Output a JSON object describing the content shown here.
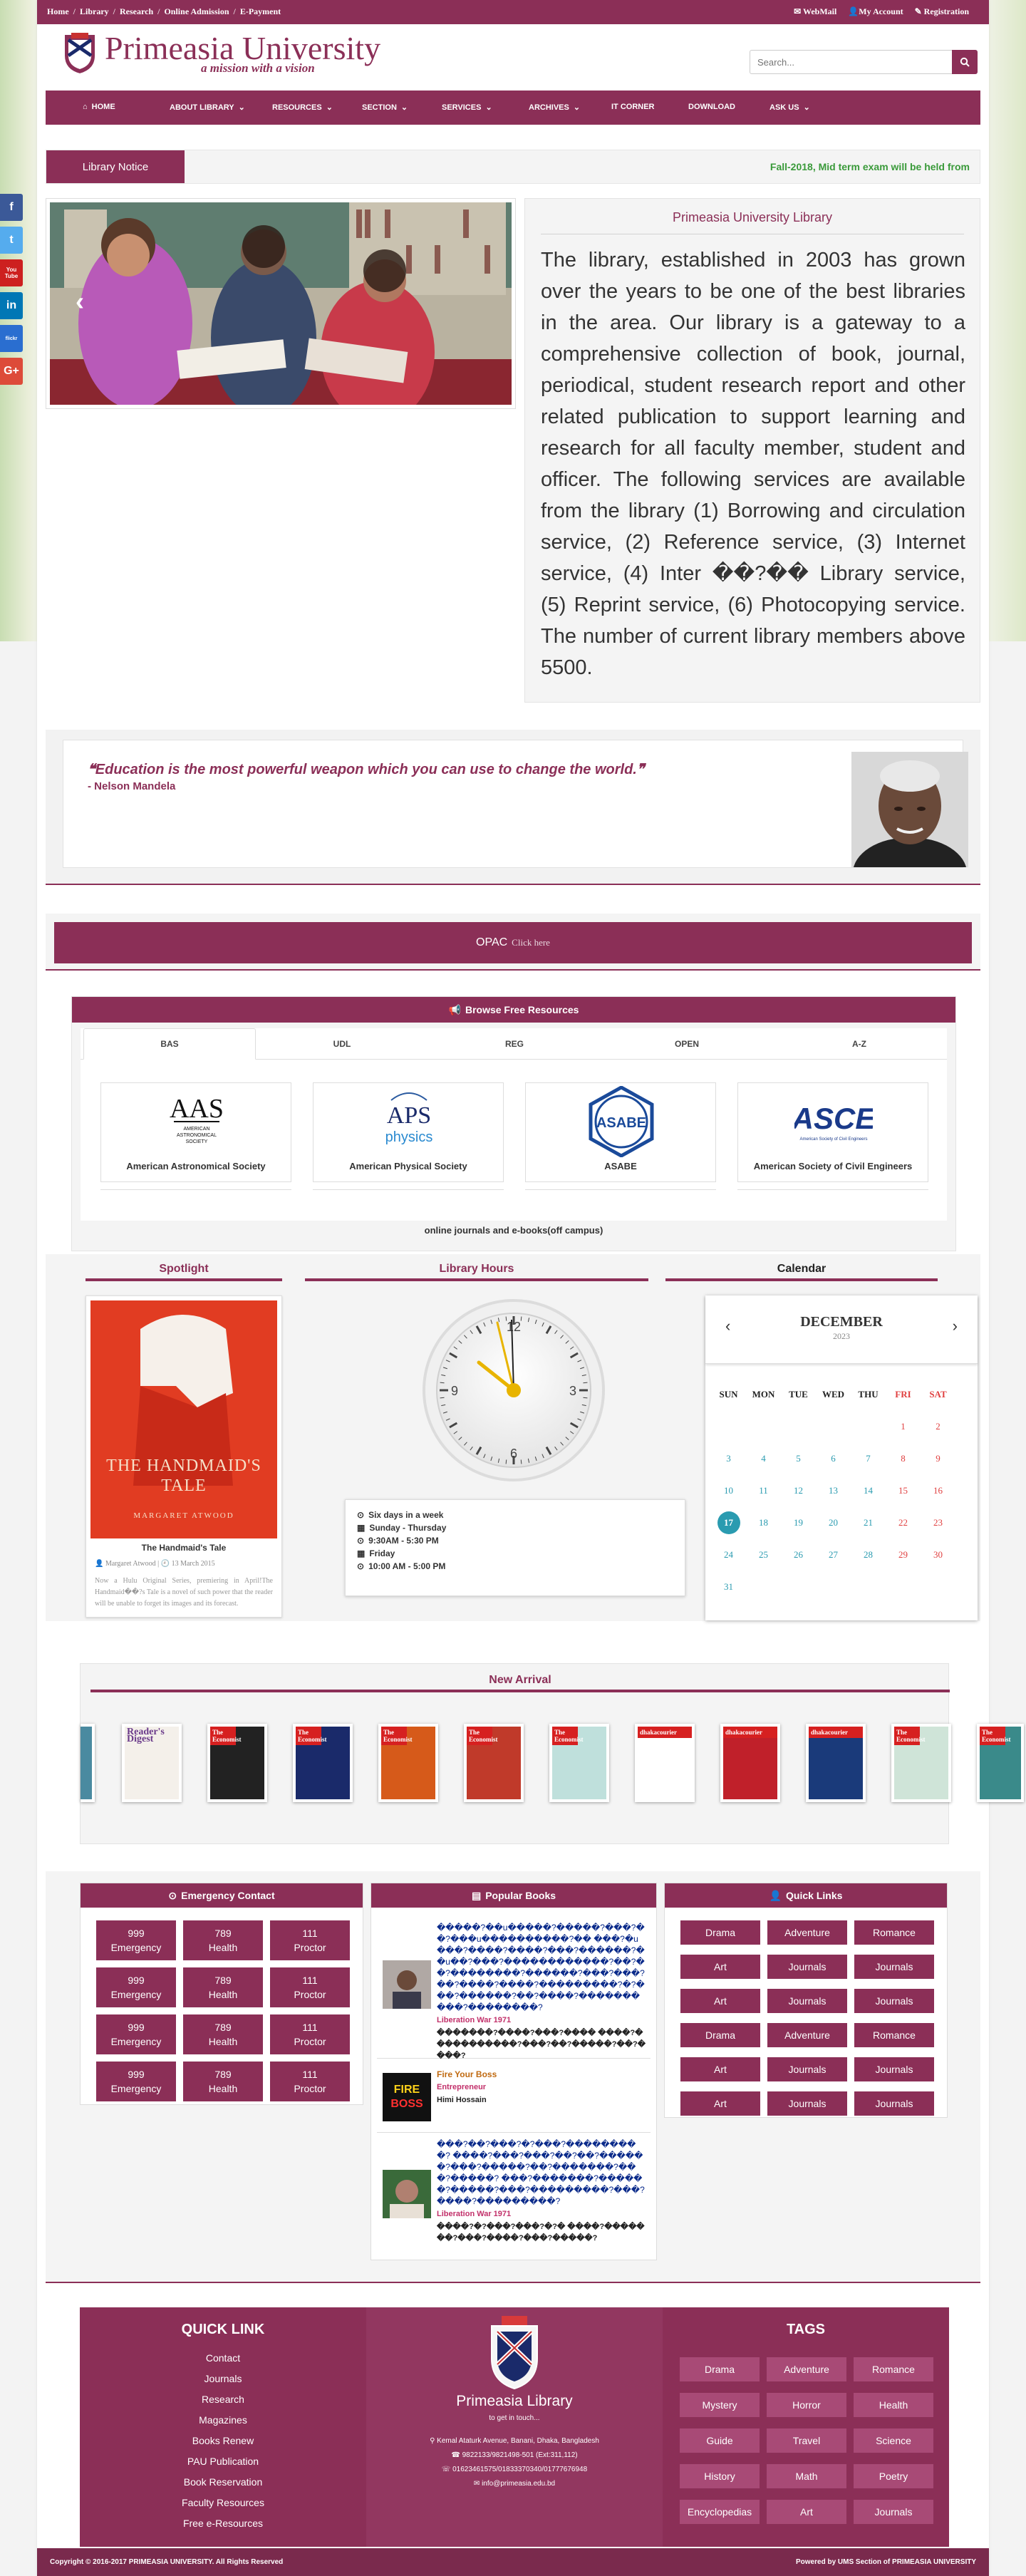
{
  "colors": {
    "brand": "#8b2f57",
    "notice_text": "#3a9a3a",
    "calendar_today": "#2a9bb0"
  },
  "topbar": {
    "links": [
      "Home",
      "Library",
      "Research",
      "Online Admission",
      "E-Payment"
    ],
    "right": {
      "webmail": "WebMail",
      "account": "My Account",
      "registration": "Registration"
    }
  },
  "header": {
    "title": "Primeasia University",
    "tagline": "a mission with a vision",
    "search_placeholder": "Search..."
  },
  "nav": {
    "items": [
      {
        "label": "HOME",
        "icon": "home-icon"
      },
      {
        "label": "ABOUT LIBRARY",
        "dropdown": true
      },
      {
        "label": "RESOURCES",
        "dropdown": true
      },
      {
        "label": "SECTION",
        "dropdown": true
      },
      {
        "label": "SERVICES",
        "dropdown": true
      },
      {
        "label": "ARCHIVES",
        "dropdown": true
      },
      {
        "label": "IT CORNER"
      },
      {
        "label": "DOWNLOAD"
      },
      {
        "label": "ASK US",
        "dropdown": true
      }
    ]
  },
  "notice": {
    "label": "Library Notice",
    "text": "Fall-2018, Mid term exam will be held from"
  },
  "social": [
    "f",
    "t",
    "You Tube",
    "in",
    "flickr",
    "G+"
  ],
  "about": {
    "title": "Primeasia University Library",
    "text": "The library, established in 2003 has grown over the years to be one of the best libraries in the area. Our library is a gateway to a comprehensive collection of book, journal, periodical, student research report and other related publication to support learning and research for all faculty member, student and officer. The following services are available from the library (1) Borrowing and circulation service, (2) Reference service, (3) Internet service, (4) Inter ��?�� Library service, (5) Reprint service, (6) Photocopying service. The number of current library members above 5500."
  },
  "quote": {
    "text": "Education is the most powerful weapon which you can use to change the world.",
    "author": "- Nelson Mandela"
  },
  "opac": {
    "label": "OPAC",
    "link": "Click here"
  },
  "resources": {
    "title": "Browse Free Resources",
    "tabs": [
      "BAS",
      "UDL",
      "REG",
      "OPEN",
      "A-Z"
    ],
    "cards": [
      {
        "name": "American Astronomical Society",
        "logo": "AAS"
      },
      {
        "name": "American Physical Society",
        "logo": "APS"
      },
      {
        "name": "ASABE",
        "logo": "ASABE"
      },
      {
        "name": "American Society of Civil Engineers",
        "logo": "ASCE"
      }
    ],
    "footer": "online journals and e-books(off campus)"
  },
  "spotlight": {
    "title": "Spotlight",
    "book_cover_title": "THE HANDMAID'S TALE",
    "book_cover_author": "MARGARET ATWOOD",
    "book": "The Handmaid's Tale",
    "author": "Margaret Atwood",
    "date": "13 March 2015",
    "desc": "Now a Hulu Original Series, premiering in April!The Handmaid��?s Tale is a novel of such power that the reader will be unable to forget its images and its forecast."
  },
  "hours": {
    "title": "Library Hours",
    "lines": [
      "Six days in a week",
      "Sunday - Thursday",
      "9:30AM - 5:30 PM",
      "Friday",
      "10:00 AM - 5:00 PM"
    ]
  },
  "calendar": {
    "title": "Calendar",
    "month": "DECEMBER",
    "year": "2023",
    "days": [
      "SUN",
      "MON",
      "TUE",
      "WED",
      "THU",
      "FRI",
      "SAT"
    ],
    "today": 17,
    "weeks": [
      [
        "",
        "",
        "",
        "",
        "",
        "1",
        "2"
      ],
      [
        "3",
        "4",
        "5",
        "6",
        "7",
        "8",
        "9"
      ],
      [
        "10",
        "11",
        "12",
        "13",
        "14",
        "15",
        "16"
      ],
      [
        "17",
        "18",
        "19",
        "20",
        "21",
        "22",
        "23"
      ],
      [
        "24",
        "25",
        "26",
        "27",
        "28",
        "29",
        "30"
      ],
      [
        "31",
        "",
        "",
        "",
        "",
        "",
        ""
      ]
    ]
  },
  "arrival": {
    "title": "New Arrival",
    "covers": [
      {
        "title": "Reader's Digest",
        "color": "#f4f0ea",
        "accent": "#6a3a8a"
      },
      {
        "title": "The Economist",
        "color": "#222",
        "accent": "#d62020"
      },
      {
        "title": "The Economist",
        "color": "#1a2a6a",
        "accent": "#d62020"
      },
      {
        "title": "The Economist",
        "color": "#d65a1a",
        "accent": "#d62020"
      },
      {
        "title": "The Economist",
        "color": "#c03a2a",
        "accent": "#d62020"
      },
      {
        "title": "The Economist",
        "color": "#bfe0dc",
        "accent": "#d62020"
      },
      {
        "title": "dhakacourier",
        "color": "#ffffff",
        "accent": "#d62020"
      },
      {
        "title": "dhakacourier",
        "color": "#c0202a",
        "accent": "#d62020"
      },
      {
        "title": "dhakacourier",
        "color": "#1a3a7a",
        "accent": "#d62020"
      },
      {
        "title": "The Economist",
        "color": "#cfe4d8",
        "accent": "#d62020"
      },
      {
        "title": "The Economist",
        "color": "#3a8a8a",
        "accent": "#d62020"
      }
    ]
  },
  "emergency": {
    "title": "Emergency Contact",
    "rows": [
      [
        {
          "num": "999",
          "label": "Emergency"
        },
        {
          "num": "789",
          "label": "Health"
        },
        {
          "num": "111",
          "label": "Proctor"
        }
      ],
      [
        {
          "num": "999",
          "label": "Emergency"
        },
        {
          "num": "789",
          "label": "Health"
        },
        {
          "num": "111",
          "label": "Proctor"
        }
      ],
      [
        {
          "num": "999",
          "label": "Emergency"
        },
        {
          "num": "789",
          "label": "Health"
        },
        {
          "num": "111",
          "label": "Proctor"
        }
      ],
      [
        {
          "num": "999",
          "label": "Emergency"
        },
        {
          "num": "789",
          "label": "Health"
        },
        {
          "num": "111",
          "label": "Proctor"
        }
      ]
    ]
  },
  "popular": {
    "title": "Popular Books",
    "items": [
      {
        "title": "�����?��u�����?�����?���?��?���u����������?�� ���?�u���?����?����?���?������?��u��?���?������������?��?��?��������?������?���?���?��?����?����?���������?�?���?������?��?����?����������?��������?",
        "category": "Liberation War 1971",
        "author": "�������?����?���?����  ����?�����������?���?��?�����?��?����?"
      },
      {
        "title": "Fire Your Boss",
        "category": "Entrepreneur",
        "author": "Himi Hossain"
      },
      {
        "title": "���?��?���?�?���?���������?  ����?���?���?��?��?������?���?�����?��?�������?���?�����?  ���?�������?������?�����?���?���������?���?����?���������?",
        "category": "Liberation War 1971",
        "author": "����?�?���?���?�?�   ����?�������?���?����?���?�����?"
      }
    ]
  },
  "quicklinks": {
    "title": "Quick Links",
    "rows": [
      [
        "Drama",
        "Adventure",
        "Romance"
      ],
      [
        "Art",
        "Journals",
        "Journals"
      ],
      [
        "Art",
        "Journals",
        "Journals"
      ],
      [
        "Drama",
        "Adventure",
        "Romance"
      ],
      [
        "Art",
        "Journals",
        "Journals"
      ],
      [
        "Art",
        "Journals",
        "Journals"
      ]
    ]
  },
  "footer": {
    "quick_title": "QUICK LINK",
    "quick_links": [
      "Contact",
      "Journals",
      "Research",
      "Magazines",
      "Books Renew",
      "PAU Publication",
      "Book Reservation",
      "Faculty Resources",
      "Free e-Resources"
    ],
    "org_name": "Primeasia Library",
    "org_tagline": "to get in touch...",
    "address": "Kemal Ataturk Avenue, Banani, Dhaka, Bangladesh",
    "phone": "9822133/9821498-501 (Ext:311,112)",
    "mobile": "01623461575/01833370340/01777676948",
    "email": "info@primeasia.edu.bd",
    "tags_title": "TAGS",
    "tags": [
      [
        "Drama",
        "Adventure",
        "Romance"
      ],
      [
        "Mystery",
        "Horror",
        "Health"
      ],
      [
        "Guide",
        "Travel",
        "Science"
      ],
      [
        "History",
        "Math",
        "Poetry"
      ],
      [
        "Encyclopedias",
        "Art",
        "Journals"
      ]
    ]
  },
  "copyright": {
    "left": "Copyright © 2016-2017 PRIMEASIA UNIVERSITY. All Rights Reserved",
    "right": "Powered by UMS Section of PRIMEASIA UNIVERSITY"
  }
}
